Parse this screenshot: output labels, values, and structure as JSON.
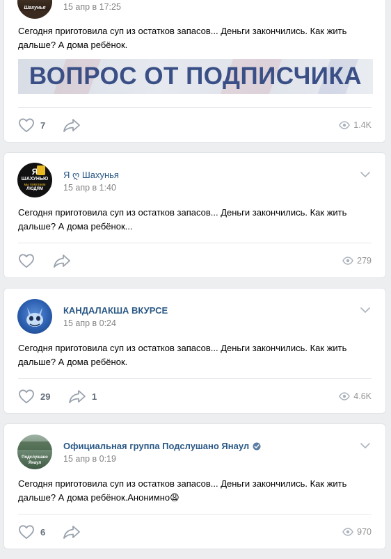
{
  "posts": [
    {
      "author": "",
      "avatar_text": "Шахунья",
      "time": "15 апр в 17:25",
      "text": "Сегодня приготовила суп из остатков запасов... Деньги закончились. Как жить дальше? А дома ребёнок.",
      "banner_text": "ВОПРОС ОТ ПОДПИСЧИКА",
      "likes": "7",
      "shares": "",
      "views": "1.4K"
    },
    {
      "author": "Я ღ Шахунья",
      "avatar_text": {
        "line1": "Я",
        "line2": "ШАХУНЬЮ",
        "line3": "мы помогаем",
        "line4": "ЛЮДЯМ"
      },
      "time": "15 апр в 1:40",
      "text": "Сегодня приготовила суп из остатков запасов... Деньги закончились. Как жить дальше? А дома ребёнок...",
      "likes": "",
      "shares": "",
      "views": "279"
    },
    {
      "author": "КАНДАЛАКША ВКУРСЕ",
      "time": "15 апр в 0:24",
      "text": "Сегодня приготовила суп из остатков запасов... Деньги закончились. Как жить дальше? А дома ребёнок.",
      "likes": "29",
      "shares": "1",
      "views": "4.6K"
    },
    {
      "author": "Официальная группа Подслушано Янаул",
      "avatar_text": {
        "line1": "Подслушано",
        "line2": "Янаул"
      },
      "time": "15 апр в 0:19",
      "text": "Сегодня приготовила суп из остатков запасов... Деньги закончились. Как жить дальше? А дома ребёнок.Анонимно😩",
      "likes": "6",
      "shares": "",
      "views": "970"
    }
  ],
  "icons": {
    "like": "heart-icon",
    "share": "share-arrow-icon",
    "views": "eye-icon",
    "menu": "chevron-down-icon",
    "verified": "verified-badge-icon"
  },
  "colors": {
    "background": "#edeef0",
    "author_link": "#2a5885",
    "meta_gray": "#828282",
    "icon_gray": "#99a2ad",
    "banner_text": "#3a4f86"
  }
}
